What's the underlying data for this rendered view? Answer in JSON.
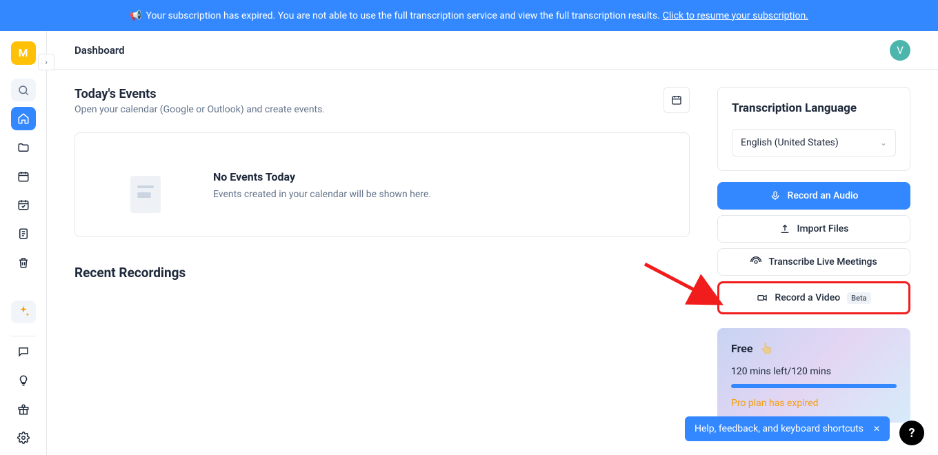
{
  "banner": {
    "icon": "📢",
    "message": "Your subscription has expired. You are not able to use the full transcription service and view the full transcription results.",
    "link_text": "Click to resume your subscription."
  },
  "sidebar": {
    "logo_letter": "M"
  },
  "header": {
    "title": "Dashboard",
    "avatar_letter": "V"
  },
  "today": {
    "title": "Today's Events",
    "subtitle": "Open your calendar (Google or Outlook) and create events.",
    "empty_title": "No Events Today",
    "empty_sub": "Events created in your calendar will be shown here."
  },
  "recent": {
    "title": "Recent Recordings"
  },
  "lang_panel": {
    "title": "Transcription Language",
    "selected": "English (United States)"
  },
  "actions": {
    "record_audio": "Record an Audio",
    "import_files": "Import Files",
    "transcribe_live": "Transcribe Live Meetings",
    "record_video": "Record a Video",
    "beta_tag": "Beta"
  },
  "free_card": {
    "title": "Free",
    "hand": "👆",
    "mins": "120 mins left/120 mins",
    "expired": "Pro plan has expired"
  },
  "help": {
    "toast": "Help, feedback, and keyboard shortcuts",
    "fab": "?"
  }
}
